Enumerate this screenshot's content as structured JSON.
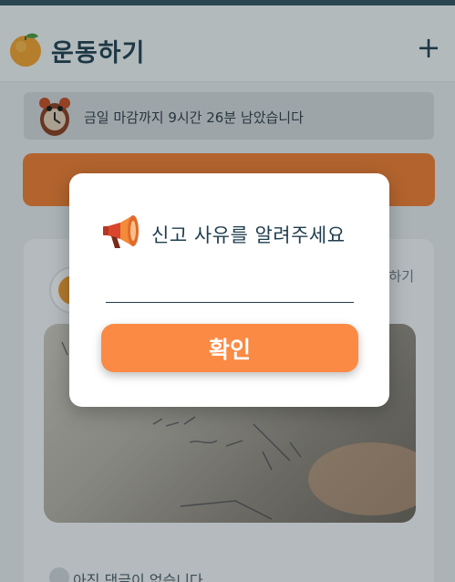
{
  "header": {
    "title": "운동하기",
    "add_label": "+"
  },
  "banner": {
    "deadline_text": "금일 마감까지 9시간 26분 남았습니다"
  },
  "background": {
    "post_action_label": "하기",
    "comment_empty_text": "아직 댓글이 없습니다"
  },
  "modal": {
    "title": "신고 사유를 알려주세요",
    "input_value": "",
    "confirm_label": "확인"
  },
  "colors": {
    "accent": "#fb8a45",
    "title_text": "#1e3d4d"
  },
  "icons": {
    "logo": "orange-icon",
    "alarm": "alarm-clock-icon",
    "modal": "megaphone-icon"
  }
}
